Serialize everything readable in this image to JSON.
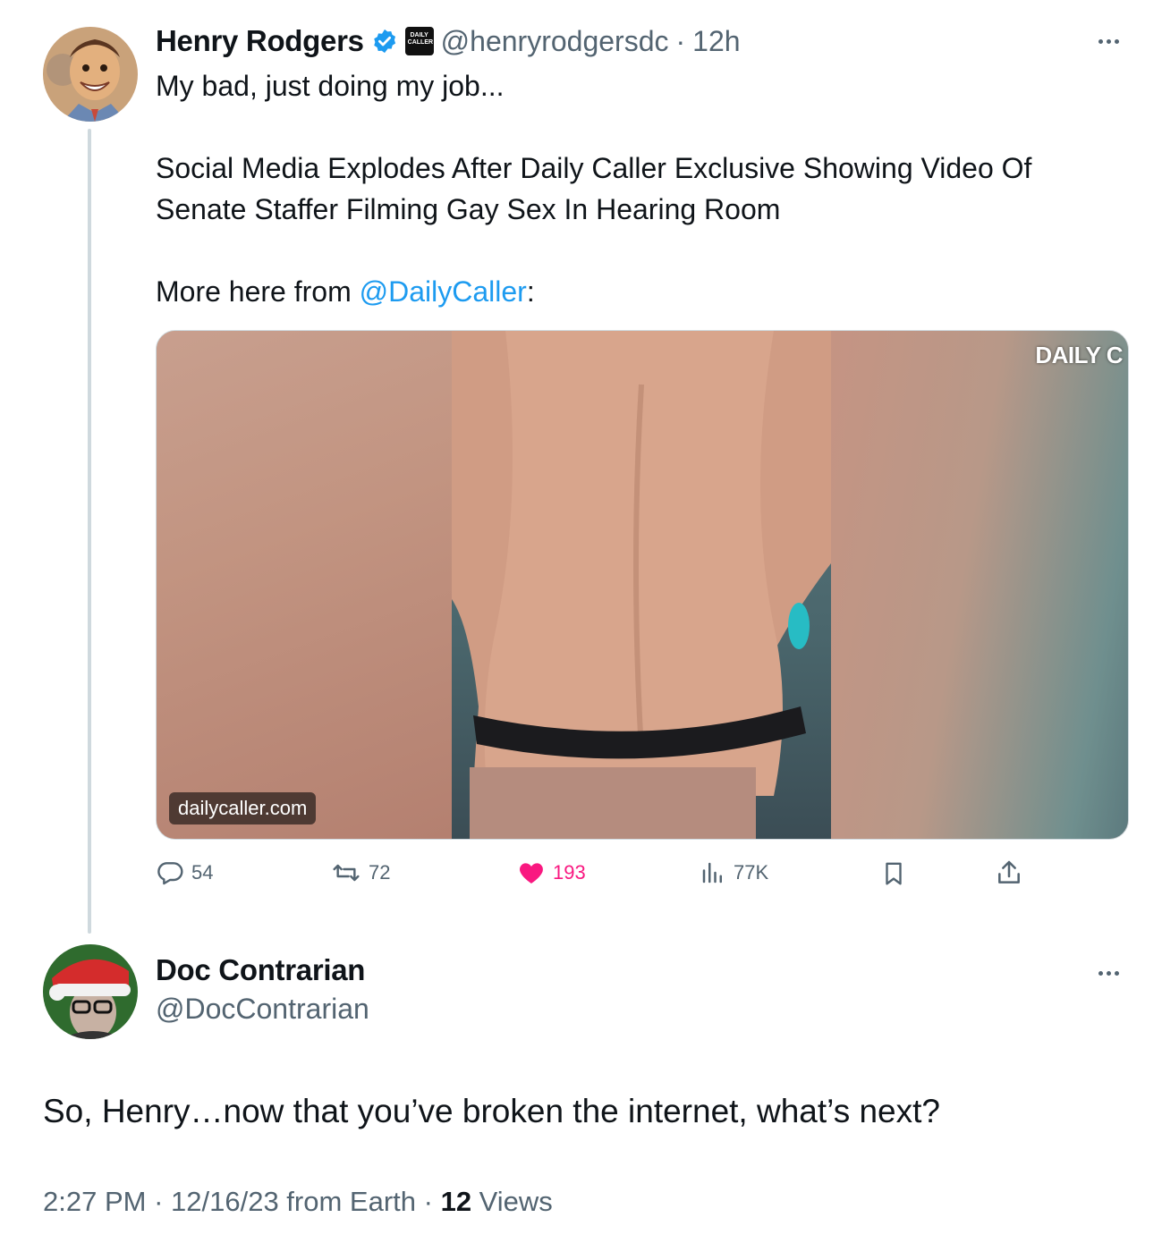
{
  "parent_tweet": {
    "author_name": "Henry Rodgers",
    "verified_icon": "verified-badge-icon",
    "affiliate_badge_text": "DAILY CALLER",
    "handle": "@henryrodgersdc",
    "separator": "·",
    "time_ago": "12h",
    "text_line1": "My bad, just doing my job...",
    "headline_line1": "Social Media Explodes After Daily Caller Exclusive Showing Video Of",
    "headline_line2": "Senate Staffer Filming Gay Sex In Hearing Room",
    "more_prefix": "More here from ",
    "mention": "@DailyCaller",
    "more_suffix": ":",
    "media": {
      "domain": "dailycaller.com",
      "watermark": "DAILY C"
    },
    "actions": {
      "replies": "54",
      "reposts": "72",
      "likes": "193",
      "views": "77K"
    },
    "colors": {
      "like": "#f91880",
      "link": "#1d9bf0",
      "muted": "#536471"
    }
  },
  "reply_tweet": {
    "author_name": "Doc Contrarian",
    "handle": "@DocContrarian",
    "text": "So, Henry…now that you’ve broken the internet, what’s next?",
    "footer": {
      "time": "2:27 PM",
      "sep1": " · ",
      "date": "12/16/23",
      "source": " from Earth",
      "sep2": " · ",
      "views_count": "12",
      "views_label": " Views"
    }
  }
}
